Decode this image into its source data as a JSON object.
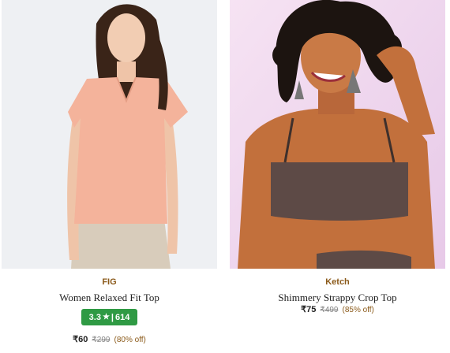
{
  "products": [
    {
      "brand": "FIG",
      "title": "Women Relaxed Fit Top",
      "rating": "3.3",
      "rating_star": "★",
      "rating_separator": "|",
      "rating_count": "614",
      "price": "₹60",
      "mrp": "₹299",
      "discount": "(80% off)",
      "image_alt": "woman-in-peach-top"
    },
    {
      "brand": "Ketch",
      "title": "Shimmery Strappy Crop Top",
      "price": "₹75",
      "mrp": "₹499",
      "discount": "(85% off)",
      "image_alt": "woman-in-shimmer-crop-top"
    }
  ],
  "colors": {
    "brand": "#8b5a1a",
    "rating_badge": "#2f9a44",
    "mrp": "#878787"
  }
}
